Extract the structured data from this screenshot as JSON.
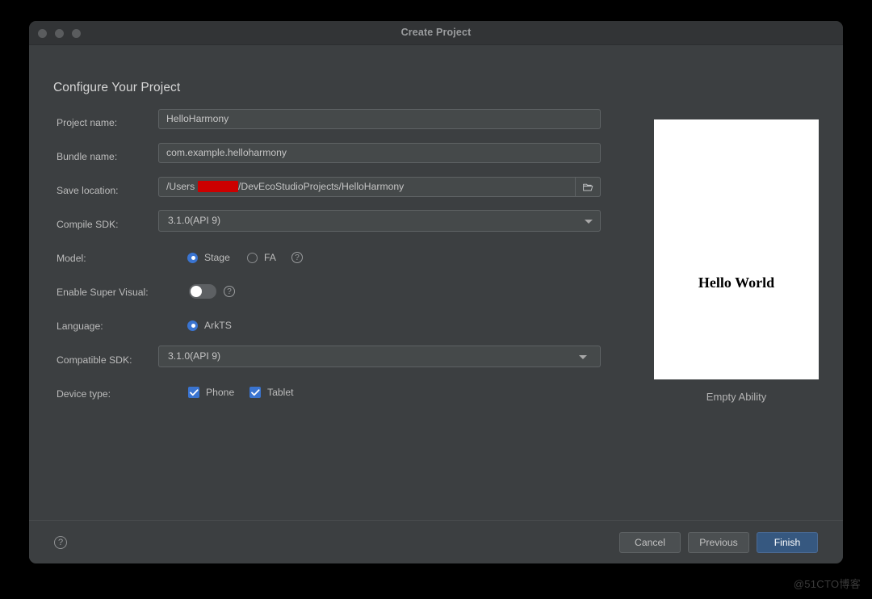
{
  "window": {
    "title": "Create Project",
    "traffic_lights": [
      "close-dot",
      "minimize-dot",
      "zoom-dot"
    ]
  },
  "page": {
    "heading": "Configure Your Project"
  },
  "form": {
    "project_name": {
      "label": "Project name:",
      "value": "HelloHarmony"
    },
    "bundle_name": {
      "label": "Bundle name:",
      "value": "com.example.helloharmony"
    },
    "save_location": {
      "label": "Save location:",
      "value_prefix": "/Users",
      "value_suffix": "/DevEcoStudioProjects/HelloHarmony",
      "redacted": true,
      "browse_icon": "folder-icon"
    },
    "compile_sdk": {
      "label": "Compile SDK:",
      "value": "3.1.0(API 9)"
    },
    "model": {
      "label": "Model:",
      "options": [
        {
          "label": "Stage",
          "selected": true
        },
        {
          "label": "FA",
          "selected": false
        }
      ],
      "help_icon": "question-mark-icon"
    },
    "enable_super_visual": {
      "label": "Enable Super Visual:",
      "enabled": false,
      "help_icon": "question-mark-icon"
    },
    "language": {
      "label": "Language:",
      "options": [
        {
          "label": "ArkTS",
          "selected": true
        }
      ]
    },
    "compatible_sdk": {
      "label": "Compatible SDK:",
      "value": "3.1.0(API 9)"
    },
    "device_type": {
      "label": "Device type:",
      "options": [
        {
          "label": "Phone",
          "checked": true
        },
        {
          "label": "Tablet",
          "checked": true
        }
      ]
    }
  },
  "preview": {
    "screen_text": "Hello World",
    "caption": "Empty Ability"
  },
  "footer": {
    "help_icon": "question-mark-icon",
    "cancel_label": "Cancel",
    "previous_label": "Previous",
    "finish_label": "Finish"
  },
  "watermark": {
    "text": "@51CTO博客"
  },
  "colors": {
    "window_bg": "#3c3f41",
    "titlebar_bg": "#323436",
    "field_bg": "#45494a",
    "field_border": "#5e6264",
    "accent": "#3a74d0",
    "primary_button": "#365880",
    "redaction": "#cc0000",
    "text": "#bcbcbc",
    "page_bg": "#000000"
  }
}
